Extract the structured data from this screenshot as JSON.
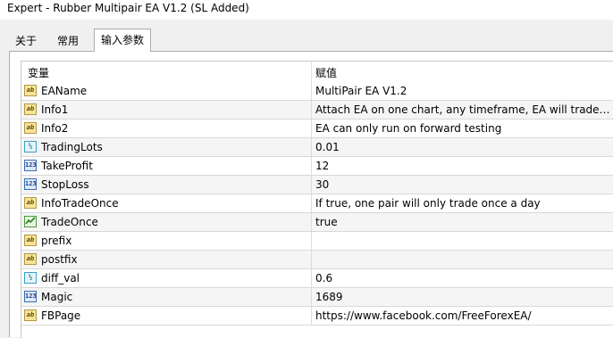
{
  "window": {
    "title": "Expert - Rubber Multipair EA V1.2 (SL Added)"
  },
  "tabs": [
    {
      "label": "关于"
    },
    {
      "label": "常用"
    },
    {
      "label": "输入参数",
      "active": true
    }
  ],
  "grid": {
    "columns": {
      "variable": "变量",
      "value": "赋值"
    },
    "rows": [
      {
        "icon": "ab-string-icon",
        "name": "EAName",
        "value": "MultiPair EA V1.2"
      },
      {
        "icon": "ab-string-icon",
        "name": "Info1",
        "value": "Attach EA on one chart, any timeframe, EA will trade ..."
      },
      {
        "icon": "ab-string-icon",
        "name": "Info2",
        "value": "EA can only run on forward testing"
      },
      {
        "icon": "fraction-double-icon",
        "name": "TradingLots",
        "value": "0.01"
      },
      {
        "icon": "integer-123-icon",
        "name": "TakeProfit",
        "value": "12"
      },
      {
        "icon": "integer-123-icon",
        "name": "StopLoss",
        "value": "30"
      },
      {
        "icon": "ab-string-icon",
        "name": "InfoTradeOnce",
        "value": "If true, one pair will only trade once a day"
      },
      {
        "icon": "boolean-icon",
        "name": "TradeOnce",
        "value": "true"
      },
      {
        "icon": "ab-string-icon",
        "name": "prefix",
        "value": ""
      },
      {
        "icon": "ab-string-icon",
        "name": "postfix",
        "value": ""
      },
      {
        "icon": "fraction-double-icon",
        "name": "diff_val",
        "value": "0.6"
      },
      {
        "icon": "integer-123-icon",
        "name": "Magic",
        "value": "1689"
      },
      {
        "icon": "ab-string-icon",
        "name": "FBPage",
        "value": "https://www.facebook.com/FreeForexEA/"
      }
    ]
  },
  "colors": {
    "window_bg": "#f0f0f0",
    "panel_bg": "#ffffff",
    "alt_row_bg": "#f5f5f5",
    "string_icon": "#f7e39a",
    "integer_icon": "#dde8f6",
    "double_icon": "#e6f5f9",
    "bool_icon": "#e8f7e4"
  }
}
